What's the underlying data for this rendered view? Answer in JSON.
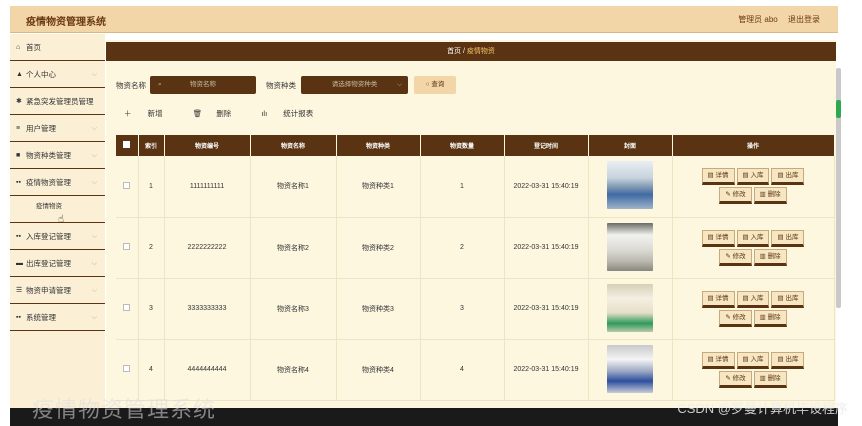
{
  "app": {
    "title": "疫情物资管理系统",
    "user_label": "管理员 abo",
    "logout": "退出登录"
  },
  "sidebar": {
    "items": [
      {
        "label": "首页",
        "icon": "home-icon"
      },
      {
        "label": "个人中心",
        "icon": "person-icon"
      },
      {
        "label": "紧急突发管理员管理",
        "icon": "gear-icon"
      },
      {
        "label": "用户管理",
        "icon": "list-icon"
      },
      {
        "label": "物资种类管理",
        "icon": "box-icon"
      },
      {
        "label": "疫情物资管理",
        "icon": "grid-icon"
      },
      {
        "label": "入库登记管理",
        "icon": "grid-icon"
      },
      {
        "label": "出库登记管理",
        "icon": "truck-icon"
      },
      {
        "label": "物资申请管理",
        "icon": "sliders-icon"
      },
      {
        "label": "系统管理",
        "icon": "grid-icon"
      }
    ],
    "sub_item": "疫情物资"
  },
  "breadcrumb": {
    "home": "首页",
    "sep": "/",
    "current": "疫情物资"
  },
  "search": {
    "name_label": "物资名称",
    "name_placeholder": "物资名称",
    "type_label": "物资种类",
    "type_placeholder": "请选择物资种类",
    "query_button": "查询"
  },
  "toolbar": {
    "add": "新增",
    "delete": "删除",
    "report": "统计报表"
  },
  "table": {
    "headers": [
      "索引",
      "物资编号",
      "物资名称",
      "物资种类",
      "物资数量",
      "登记时间",
      "封面",
      "操作"
    ],
    "rows": [
      {
        "index": "1",
        "code": "1111111111",
        "name": "物资名称1",
        "type": "物资种类1",
        "qty": "1",
        "time": "2022-03-31 15:40:19"
      },
      {
        "index": "2",
        "code": "2222222222",
        "name": "物资名称2",
        "type": "物资种类2",
        "qty": "2",
        "time": "2022-03-31 15:40:19"
      },
      {
        "index": "3",
        "code": "3333333333",
        "name": "物资名称3",
        "type": "物资种类3",
        "qty": "3",
        "time": "2022-03-31 15:40:19"
      },
      {
        "index": "4",
        "code": "4444444444",
        "name": "物资名称4",
        "type": "物资种类4",
        "qty": "4",
        "time": "2022-03-31 15:40:19"
      }
    ],
    "ops": {
      "detail": "详情",
      "in": "入库",
      "out": "出库",
      "edit": "修改",
      "del": "删除"
    }
  },
  "watermark": {
    "left": "疫情物资管理系统",
    "right": "CSDN @罗曼计算机毕设程序"
  },
  "colors": {
    "brown": "#5a3412",
    "tan": "#f2d6a7",
    "cream": "#fdf7e0"
  }
}
